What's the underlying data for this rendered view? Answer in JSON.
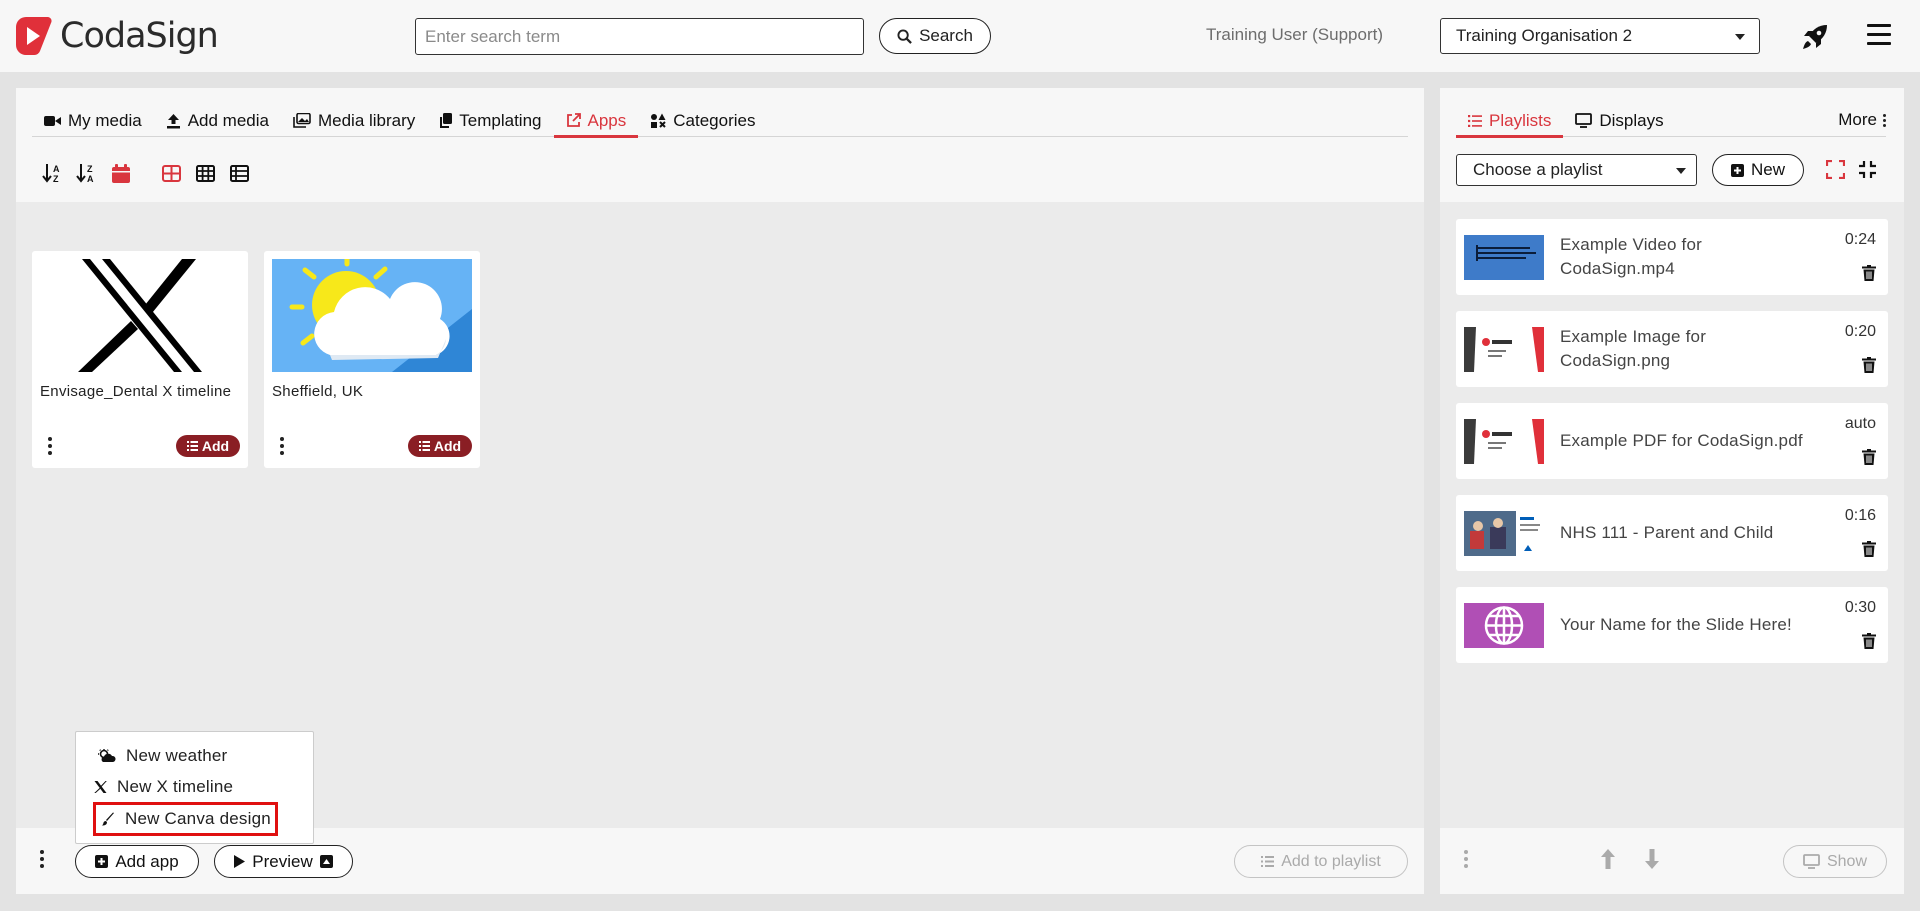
{
  "colors": {
    "accent": "#d9363e",
    "add_button": "#8a1e24",
    "highlight": "#e01010"
  },
  "header": {
    "logo_text": "CodaSign",
    "search_placeholder": "Enter search term",
    "search_label": "Search",
    "user": "Training User (Support)",
    "organisation": "Training Organisation 2"
  },
  "media_tabs": [
    {
      "label": "My media",
      "icon": "video-camera-icon"
    },
    {
      "label": "Add media",
      "icon": "upload-icon"
    },
    {
      "label": "Media library",
      "icon": "images-icon"
    },
    {
      "label": "Templating",
      "icon": "copy-icon"
    },
    {
      "label": "Apps",
      "icon": "external-link-icon",
      "active": true
    },
    {
      "label": "Categories",
      "icon": "shapes-icon"
    }
  ],
  "apps": [
    {
      "title": "Envisage_Dental X timeline",
      "add_label": "Add",
      "thumb": "x-logo-icon"
    },
    {
      "title": "Sheffield, UK",
      "add_label": "Add",
      "thumb": "weather-cloud-sun-icon"
    }
  ],
  "add_menu": [
    {
      "label": "New weather",
      "icon": "cloud-sun-icon"
    },
    {
      "label": "New X timeline",
      "icon": "x-icon"
    },
    {
      "label": "New Canva design",
      "icon": "brush-icon",
      "highlighted": true
    }
  ],
  "bottom_bar": {
    "add_app_label": "Add app",
    "preview_label": "Preview",
    "add_to_playlist_label": "Add to playlist"
  },
  "right_tabs": [
    {
      "label": "Playlists",
      "icon": "list-icon",
      "active": true
    },
    {
      "label": "Displays",
      "icon": "monitor-icon"
    }
  ],
  "more_label": "More",
  "playlist_select": "Choose a playlist",
  "new_label": "New",
  "playlist_items": [
    {
      "name": "Example Video for CodaSign.mp4",
      "duration": "0:24",
      "thumb": "blue"
    },
    {
      "name": "Example Image for CodaSign.png",
      "duration": "0:20",
      "thumb": "codasign"
    },
    {
      "name": "Example PDF for CodaSign.pdf",
      "duration": "auto",
      "thumb": "codasign"
    },
    {
      "name": "NHS 111 - Parent and Child",
      "duration": "0:16",
      "thumb": "nhs"
    },
    {
      "name": "Your Name for the Slide Here!",
      "duration": "0:30",
      "thumb": "globe"
    }
  ],
  "show_label": "Show"
}
